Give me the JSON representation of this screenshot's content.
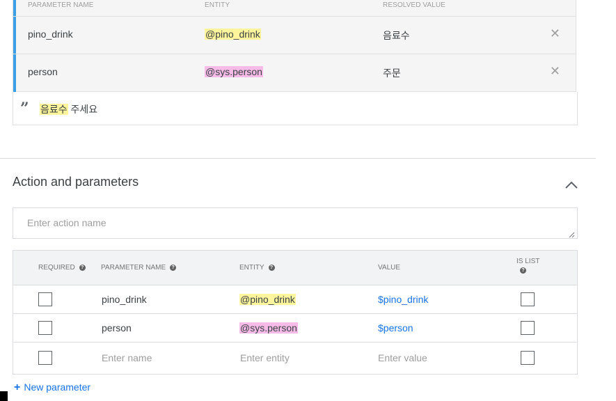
{
  "annotations": {
    "headers": {
      "parameter_name": "PARAMETER NAME",
      "entity": "ENTITY",
      "resolved_value": "RESOLVED VALUE"
    },
    "rows": [
      {
        "parameter_name": "pino_drink",
        "entity": "@pino_drink",
        "resolved_value": "음료수",
        "highlight": "#fff59d"
      },
      {
        "parameter_name": "person",
        "entity": "@sys.person",
        "resolved_value": "주문",
        "highlight": "#f8bbe8"
      }
    ],
    "phrase": {
      "highlighted": "음료수",
      "rest": " 주세요"
    }
  },
  "section": {
    "title": "Action and parameters"
  },
  "action_input": {
    "value": "",
    "placeholder": "Enter action name"
  },
  "params_table": {
    "headers": {
      "required": "REQUIRED",
      "parameter_name": "PARAMETER NAME",
      "entity": "ENTITY",
      "value": "VALUE",
      "is_list": "IS LIST"
    },
    "rows": [
      {
        "required": false,
        "name": "pino_drink",
        "entity": "@pino_drink",
        "value": "$pino_drink",
        "is_list": false
      },
      {
        "required": false,
        "name": "person",
        "entity": "@sys.person",
        "value": "$person",
        "is_list": false
      }
    ],
    "new_row": {
      "name_placeholder": "Enter name",
      "entity_placeholder": "Enter entity",
      "value_placeholder": "Enter value"
    }
  },
  "new_parameter_label": "New parameter",
  "colors": {
    "accent": "#3d9ee8",
    "link": "#1a73e8",
    "highlight_yellow": "#fff59d",
    "highlight_pink": "#f8bbe8"
  },
  "icons": [
    "close-icon",
    "quote-icon",
    "chevron-up-icon",
    "help-icon",
    "plus-icon",
    "resize-grip-icon"
  ]
}
